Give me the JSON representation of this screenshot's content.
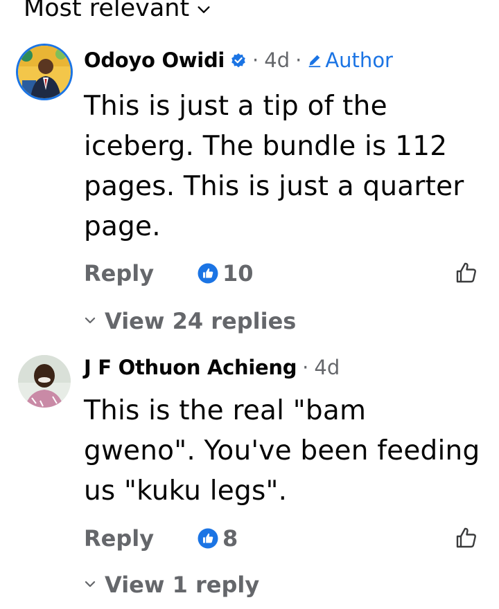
{
  "sort": {
    "label": "Most relevant",
    "icon": "chevron-down-icon"
  },
  "comments": [
    {
      "author": "Odoyo Owidi",
      "verified": true,
      "time": "4d",
      "badge": "Author",
      "text": "This is just a tip of the iceberg. The bundle is 112 pages. This is just a quarter page.",
      "reply_label": "Reply",
      "likes": "10",
      "view_replies": "View 24 replies"
    },
    {
      "author": "J F Othuon Achieng",
      "verified": false,
      "time": "4d",
      "text": "This is the real \"bam gweno\". You've been feeding us \"kuku legs\".",
      "reply_label": "Reply",
      "likes": "8",
      "view_replies": "View 1 reply"
    }
  ],
  "colors": {
    "accent": "#1b74e4",
    "secondary_text": "#65676b",
    "primary_text": "#050505"
  }
}
